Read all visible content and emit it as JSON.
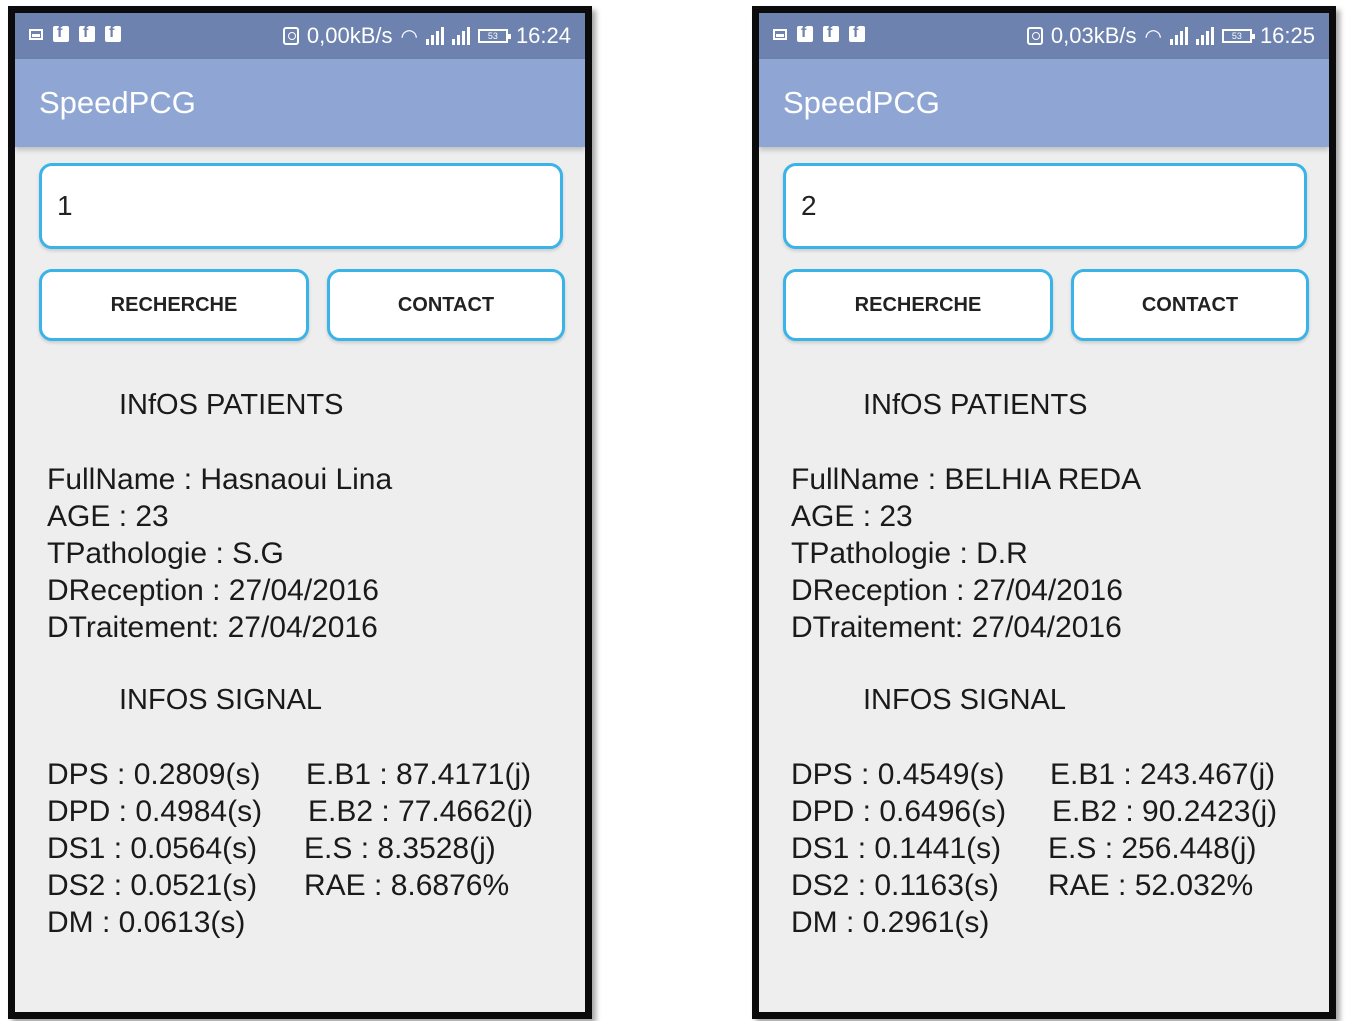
{
  "screens": [
    {
      "status": {
        "data_rate": "0,00kB/s",
        "battery": "53",
        "time": "16:24"
      },
      "app_title": "SpeedPCG",
      "search_value": "1",
      "buttons": {
        "search": "RECHERCHE",
        "contact": "CONTACT"
      },
      "patient_title": "INfOS PATIENTS",
      "patient": [
        "FullName : Hasnaoui Lina",
        "AGE : 23",
        "TPathologie : S.G",
        "DReception : 27/04/2016",
        "DTraitement: 27/04/2016"
      ],
      "signal_title": "INFOS SIGNAL",
      "signal_left": [
        "DPS : 0.2809(s)",
        "DPD : 0.4984(s)",
        "DS1 : 0.0564(s)",
        "DS2 : 0.0521(s)",
        "DM : 0.0613(s)"
      ],
      "signal_right": [
        "E.B1 : 87.4171(j)",
        "E.B2 : 77.4662(j)",
        "E.S : 8.3528(j)",
        "RAE : 8.6876%"
      ]
    },
    {
      "status": {
        "data_rate": "0,03kB/s",
        "battery": "53",
        "time": "16:25"
      },
      "app_title": "SpeedPCG",
      "search_value": "2",
      "buttons": {
        "search": "RECHERCHE",
        "contact": "CONTACT"
      },
      "patient_title": "INfOS PATIENTS",
      "patient": [
        "FullName : BELHIA REDA",
        "AGE : 23",
        "TPathologie : D.R",
        "DReception : 27/04/2016",
        "DTraitement: 27/04/2016"
      ],
      "signal_title": "INFOS SIGNAL",
      "signal_left": [
        "DPS : 0.4549(s)",
        "DPD : 0.6496(s)",
        "DS1 : 0.1441(s)",
        "DS2 : 0.1163(s)",
        "DM : 0.2961(s)"
      ],
      "signal_right": [
        "E.B1 : 243.467(j)",
        "E.B2 : 90.2423(j)",
        "E.S : 256.448(j)",
        "RAE : 52.032%"
      ]
    }
  ],
  "colors": {
    "status_bar": "#6d82ae",
    "app_bar": "#8fa6d4",
    "input_border": "#39b3e8",
    "background": "#eeeeee"
  }
}
